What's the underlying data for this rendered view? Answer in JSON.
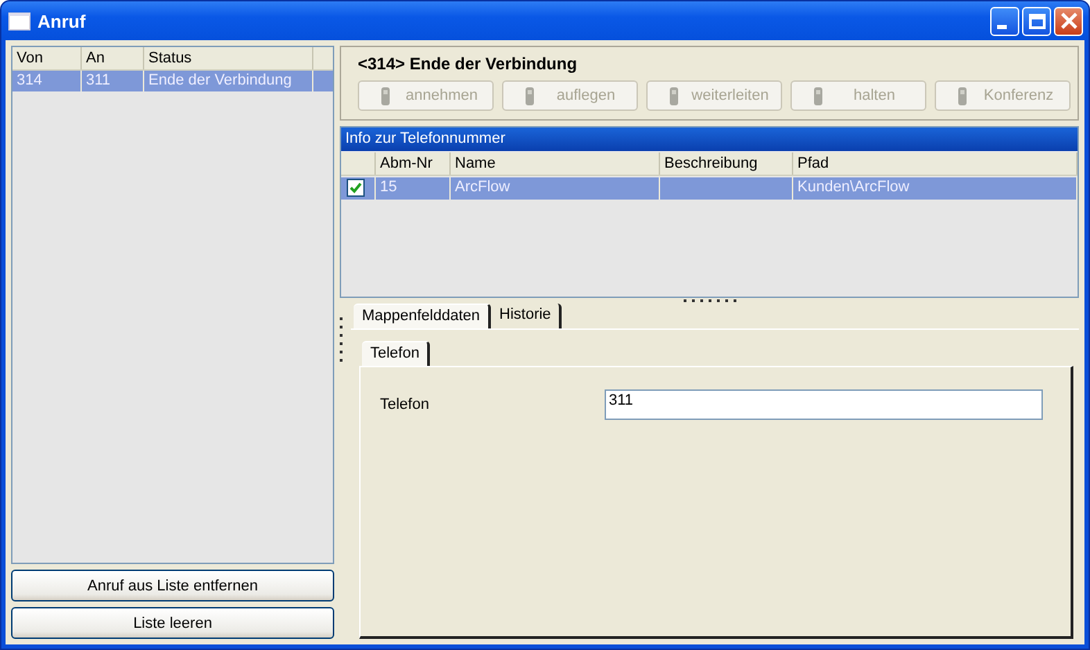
{
  "window": {
    "title": "Anruf"
  },
  "call_list": {
    "columns": [
      "Von",
      "An",
      "Status"
    ],
    "rows": [
      {
        "cells": [
          "314",
          "311",
          "Ende der Verbindung"
        ],
        "selected": true
      }
    ],
    "buttons": [
      "Anruf aus Liste entfernen",
      "Liste leeren"
    ]
  },
  "call_header": {
    "title": "<314> Ende der Verbindung",
    "actions": [
      {
        "label": "annehmen",
        "disabled": true
      },
      {
        "label": "auflegen",
        "disabled": true
      },
      {
        "label": "weiterleiten",
        "disabled": true
      },
      {
        "label": "halten",
        "disabled": true
      },
      {
        "label": "Konferenz",
        "disabled": true
      }
    ]
  },
  "info_panel": {
    "title": "Info zur Telefonnummer",
    "columns": [
      "Abm-Nr",
      "Name",
      "Beschreibung",
      "Pfad"
    ],
    "rows": [
      {
        "checked": true,
        "selected": true,
        "abm_nr": "15",
        "name": "ArcFlow",
        "pfad": "Kunden\\ArcFlow"
      }
    ]
  },
  "tabs": [
    {
      "label": "Mappenfelddaten",
      "selected": true
    },
    {
      "label": "Historie",
      "selected": false
    }
  ],
  "sub_tabs": [
    {
      "label": "Telefon",
      "selected": true
    }
  ],
  "fields": [
    {
      "label": "Telefon",
      "value": "311"
    }
  ]
}
